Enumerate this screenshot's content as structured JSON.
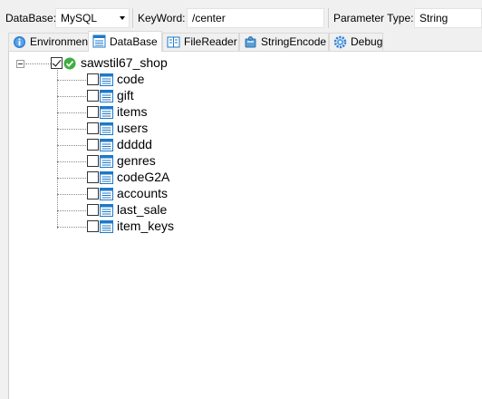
{
  "toolbar": {
    "database_label": "DataBase:",
    "database_value": "MySQL",
    "keyword_label": "KeyWord:",
    "keyword_value": "/center",
    "param_type_label": "Parameter Type:",
    "param_type_value": "String"
  },
  "tabs": [
    {
      "label": "Environment",
      "icon": "info-icon"
    },
    {
      "label": "DataBase",
      "icon": "database-icon",
      "active": true
    },
    {
      "label": "FileReader",
      "icon": "book-icon"
    },
    {
      "label": "StringEncode",
      "icon": "puzzle-icon"
    },
    {
      "label": "Debug",
      "icon": "gear-icon"
    }
  ],
  "tree": {
    "root": {
      "label": "sawstil67_shop",
      "checked": true,
      "status_icon": "green-check-icon"
    },
    "tables": [
      {
        "label": "code",
        "checked": false
      },
      {
        "label": "gift",
        "checked": false
      },
      {
        "label": "items",
        "checked": false
      },
      {
        "label": "users",
        "checked": false
      },
      {
        "label": "ddddd",
        "checked": false
      },
      {
        "label": "genres",
        "checked": false
      },
      {
        "label": "codeG2A",
        "checked": false
      },
      {
        "label": "accounts",
        "checked": false
      },
      {
        "label": "last_sale",
        "checked": false
      },
      {
        "label": "item_keys",
        "checked": false
      }
    ]
  },
  "colors": {
    "accent_blue": "#1e78c8",
    "status_green": "#3fae3f"
  }
}
